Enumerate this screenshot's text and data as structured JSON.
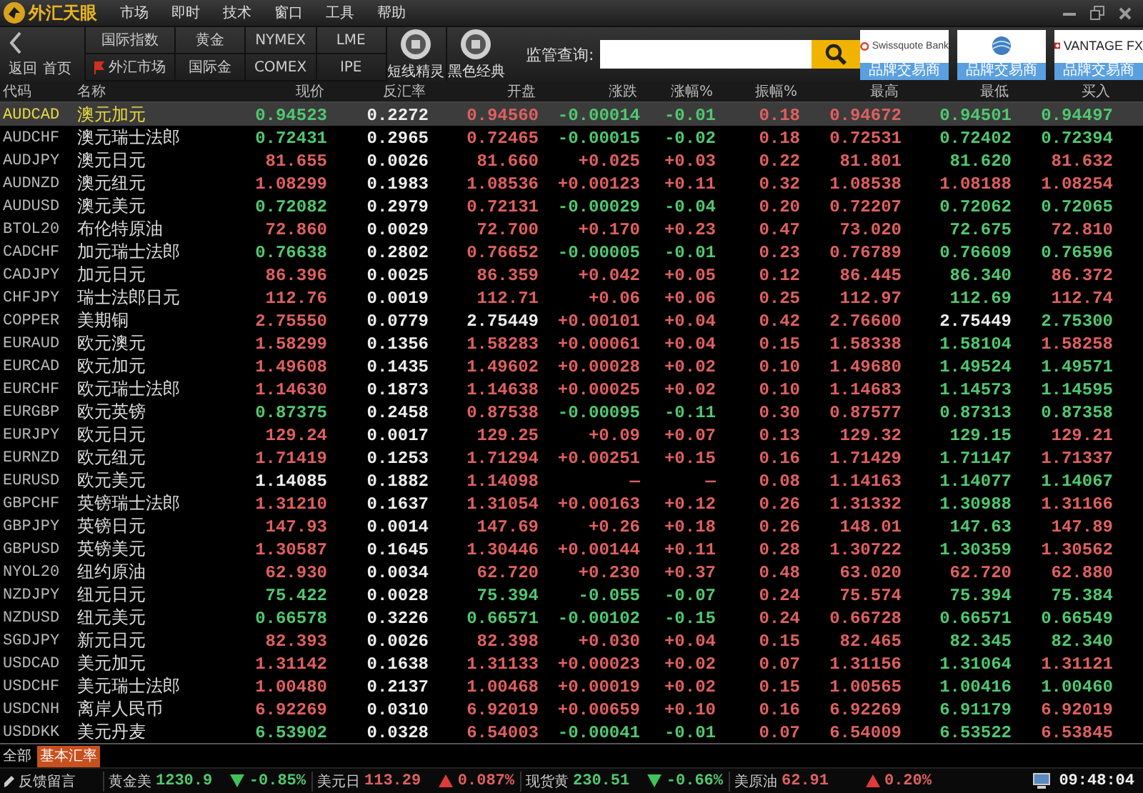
{
  "app": {
    "logo": "外汇天眼",
    "menu": [
      "市场",
      "即时",
      "技术",
      "窗口",
      "工具",
      "帮助"
    ]
  },
  "toolbar": {
    "back": "返回",
    "home": "首页",
    "markets": [
      {
        "top": "国际指数",
        "bottom": "外汇市场",
        "flag": true
      },
      {
        "top": "黄金",
        "bottom": "国际金",
        "flag": false
      },
      {
        "top": "NYMEX",
        "bottom": "COMEX",
        "flag": false
      },
      {
        "top": "LME",
        "bottom": "IPE",
        "flag": false
      }
    ],
    "tools": [
      "短线精灵",
      "黑色经典"
    ],
    "search": {
      "label": "监管查询:"
    },
    "brokers": [
      {
        "kind": "swiss",
        "name": "Swissquote Bank",
        "tag": "品牌交易商"
      },
      {
        "kind": "globe",
        "tag": "品牌交易商"
      },
      {
        "kind": "vantage",
        "name": "VANTAGE FX",
        "tag": "品牌交易商"
      }
    ]
  },
  "table": {
    "columns": [
      "代码",
      "名称",
      "现价",
      "反汇率",
      "开盘",
      "涨跌",
      "涨幅%",
      "振幅%",
      "最高",
      "最低",
      "买入"
    ],
    "rows": [
      {
        "selected": true,
        "cells": [
          {
            "text": "AUDCAD"
          },
          {
            "text": "澳元加元"
          },
          {
            "text": "0.94523",
            "color": "#50c870"
          },
          {
            "text": "0.2272",
            "color": "#eeeeee"
          },
          {
            "text": "0.94560",
            "color": "#e06060"
          },
          {
            "text": "-0.00014",
            "color": "#50c870"
          },
          {
            "text": "-0.01",
            "color": "#50c870"
          },
          {
            "text": "0.18",
            "color": "#e06060"
          },
          {
            "text": "0.94672",
            "color": "#e06060"
          },
          {
            "text": "0.94501",
            "color": "#50c870"
          },
          {
            "text": "0.94497",
            "color": "#50c870"
          }
        ]
      },
      {
        "selected": false,
        "cells": [
          {
            "text": "AUDCHF"
          },
          {
            "text": "澳元瑞士法郎"
          },
          {
            "text": "0.72431",
            "color": "#50c870"
          },
          {
            "text": "0.2965",
            "color": "#eeeeee"
          },
          {
            "text": "0.72465",
            "color": "#e06060"
          },
          {
            "text": "-0.00015",
            "color": "#50c870"
          },
          {
            "text": "-0.02",
            "color": "#50c870"
          },
          {
            "text": "0.18",
            "color": "#e06060"
          },
          {
            "text": "0.72531",
            "color": "#e06060"
          },
          {
            "text": "0.72402",
            "color": "#50c870"
          },
          {
            "text": "0.72394",
            "color": "#50c870"
          }
        ]
      },
      {
        "selected": false,
        "cells": [
          {
            "text": "AUDJPY"
          },
          {
            "text": "澳元日元"
          },
          {
            "text": "81.655",
            "color": "#e06060"
          },
          {
            "text": "0.0026",
            "color": "#eeeeee"
          },
          {
            "text": "81.660",
            "color": "#e06060"
          },
          {
            "text": "+0.025",
            "color": "#e06060"
          },
          {
            "text": "+0.03",
            "color": "#e06060"
          },
          {
            "text": "0.22",
            "color": "#e06060"
          },
          {
            "text": "81.801",
            "color": "#e06060"
          },
          {
            "text": "81.620",
            "color": "#50c870"
          },
          {
            "text": "81.632",
            "color": "#e06060"
          }
        ]
      },
      {
        "selected": false,
        "cells": [
          {
            "text": "AUDNZD"
          },
          {
            "text": "澳元纽元"
          },
          {
            "text": "1.08299",
            "color": "#e06060"
          },
          {
            "text": "0.1983",
            "color": "#eeeeee"
          },
          {
            "text": "1.08536",
            "color": "#e06060"
          },
          {
            "text": "+0.00123",
            "color": "#e06060"
          },
          {
            "text": "+0.11",
            "color": "#e06060"
          },
          {
            "text": "0.32",
            "color": "#e06060"
          },
          {
            "text": "1.08538",
            "color": "#e06060"
          },
          {
            "text": "1.08188",
            "color": "#e06060"
          },
          {
            "text": "1.08254",
            "color": "#e06060"
          }
        ]
      },
      {
        "selected": false,
        "cells": [
          {
            "text": "AUDUSD"
          },
          {
            "text": "澳元美元"
          },
          {
            "text": "0.72082",
            "color": "#50c870"
          },
          {
            "text": "0.2979",
            "color": "#eeeeee"
          },
          {
            "text": "0.72131",
            "color": "#e06060"
          },
          {
            "text": "-0.00029",
            "color": "#50c870"
          },
          {
            "text": "-0.04",
            "color": "#50c870"
          },
          {
            "text": "0.20",
            "color": "#e06060"
          },
          {
            "text": "0.72207",
            "color": "#e06060"
          },
          {
            "text": "0.72062",
            "color": "#50c870"
          },
          {
            "text": "0.72065",
            "color": "#50c870"
          }
        ]
      },
      {
        "selected": false,
        "cells": [
          {
            "text": "BTOL20"
          },
          {
            "text": "布伦特原油"
          },
          {
            "text": "72.860",
            "color": "#e06060"
          },
          {
            "text": "0.0029",
            "color": "#eeeeee"
          },
          {
            "text": "72.700",
            "color": "#e06060"
          },
          {
            "text": "+0.170",
            "color": "#e06060"
          },
          {
            "text": "+0.23",
            "color": "#e06060"
          },
          {
            "text": "0.47",
            "color": "#e06060"
          },
          {
            "text": "73.020",
            "color": "#e06060"
          },
          {
            "text": "72.675",
            "color": "#50c870"
          },
          {
            "text": "72.810",
            "color": "#e06060"
          }
        ]
      },
      {
        "selected": false,
        "cells": [
          {
            "text": "CADCHF"
          },
          {
            "text": "加元瑞士法郎"
          },
          {
            "text": "0.76638",
            "color": "#50c870"
          },
          {
            "text": "0.2802",
            "color": "#eeeeee"
          },
          {
            "text": "0.76652",
            "color": "#e06060"
          },
          {
            "text": "-0.00005",
            "color": "#50c870"
          },
          {
            "text": "-0.01",
            "color": "#50c870"
          },
          {
            "text": "0.23",
            "color": "#e06060"
          },
          {
            "text": "0.76789",
            "color": "#e06060"
          },
          {
            "text": "0.76609",
            "color": "#50c870"
          },
          {
            "text": "0.76596",
            "color": "#50c870"
          }
        ]
      },
      {
        "selected": false,
        "cells": [
          {
            "text": "CADJPY"
          },
          {
            "text": "加元日元"
          },
          {
            "text": "86.396",
            "color": "#e06060"
          },
          {
            "text": "0.0025",
            "color": "#eeeeee"
          },
          {
            "text": "86.359",
            "color": "#e06060"
          },
          {
            "text": "+0.042",
            "color": "#e06060"
          },
          {
            "text": "+0.05",
            "color": "#e06060"
          },
          {
            "text": "0.12",
            "color": "#e06060"
          },
          {
            "text": "86.445",
            "color": "#e06060"
          },
          {
            "text": "86.340",
            "color": "#50c870"
          },
          {
            "text": "86.372",
            "color": "#e06060"
          }
        ]
      },
      {
        "selected": false,
        "cells": [
          {
            "text": "CHFJPY"
          },
          {
            "text": "瑞士法郎日元"
          },
          {
            "text": "112.76",
            "color": "#e06060"
          },
          {
            "text": "0.0019",
            "color": "#eeeeee"
          },
          {
            "text": "112.71",
            "color": "#e06060"
          },
          {
            "text": "+0.06",
            "color": "#e06060"
          },
          {
            "text": "+0.06",
            "color": "#e06060"
          },
          {
            "text": "0.25",
            "color": "#e06060"
          },
          {
            "text": "112.97",
            "color": "#e06060"
          },
          {
            "text": "112.69",
            "color": "#50c870"
          },
          {
            "text": "112.74",
            "color": "#e06060"
          }
        ]
      },
      {
        "selected": false,
        "cells": [
          {
            "text": "COPPER"
          },
          {
            "text": "美期铜"
          },
          {
            "text": "2.75550",
            "color": "#e06060"
          },
          {
            "text": "0.0779",
            "color": "#eeeeee"
          },
          {
            "text": "2.75449",
            "color": "#eeeeee"
          },
          {
            "text": "+0.00101",
            "color": "#e06060"
          },
          {
            "text": "+0.04",
            "color": "#e06060"
          },
          {
            "text": "0.42",
            "color": "#e06060"
          },
          {
            "text": "2.76600",
            "color": "#e06060"
          },
          {
            "text": "2.75449",
            "color": "#eeeeee"
          },
          {
            "text": "2.75300",
            "color": "#50c870"
          }
        ]
      },
      {
        "selected": false,
        "cells": [
          {
            "text": "EURAUD"
          },
          {
            "text": "欧元澳元"
          },
          {
            "text": "1.58299",
            "color": "#e06060"
          },
          {
            "text": "0.1356",
            "color": "#eeeeee"
          },
          {
            "text": "1.58283",
            "color": "#e06060"
          },
          {
            "text": "+0.00061",
            "color": "#e06060"
          },
          {
            "text": "+0.04",
            "color": "#e06060"
          },
          {
            "text": "0.15",
            "color": "#e06060"
          },
          {
            "text": "1.58338",
            "color": "#e06060"
          },
          {
            "text": "1.58104",
            "color": "#50c870"
          },
          {
            "text": "1.58258",
            "color": "#e06060"
          }
        ]
      },
      {
        "selected": false,
        "cells": [
          {
            "text": "EURCAD"
          },
          {
            "text": "欧元加元"
          },
          {
            "text": "1.49608",
            "color": "#e06060"
          },
          {
            "text": "0.1435",
            "color": "#eeeeee"
          },
          {
            "text": "1.49602",
            "color": "#e06060"
          },
          {
            "text": "+0.00028",
            "color": "#e06060"
          },
          {
            "text": "+0.02",
            "color": "#e06060"
          },
          {
            "text": "0.10",
            "color": "#e06060"
          },
          {
            "text": "1.49680",
            "color": "#e06060"
          },
          {
            "text": "1.49524",
            "color": "#50c870"
          },
          {
            "text": "1.49571",
            "color": "#50c870"
          }
        ]
      },
      {
        "selected": false,
        "cells": [
          {
            "text": "EURCHF"
          },
          {
            "text": "欧元瑞士法郎"
          },
          {
            "text": "1.14630",
            "color": "#e06060"
          },
          {
            "text": "0.1873",
            "color": "#eeeeee"
          },
          {
            "text": "1.14638",
            "color": "#e06060"
          },
          {
            "text": "+0.00025",
            "color": "#e06060"
          },
          {
            "text": "+0.02",
            "color": "#e06060"
          },
          {
            "text": "0.10",
            "color": "#e06060"
          },
          {
            "text": "1.14683",
            "color": "#e06060"
          },
          {
            "text": "1.14573",
            "color": "#50c870"
          },
          {
            "text": "1.14595",
            "color": "#50c870"
          }
        ]
      },
      {
        "selected": false,
        "cells": [
          {
            "text": "EURGBP"
          },
          {
            "text": "欧元英镑"
          },
          {
            "text": "0.87375",
            "color": "#50c870"
          },
          {
            "text": "0.2458",
            "color": "#eeeeee"
          },
          {
            "text": "0.87538",
            "color": "#e06060"
          },
          {
            "text": "-0.00095",
            "color": "#50c870"
          },
          {
            "text": "-0.11",
            "color": "#50c870"
          },
          {
            "text": "0.30",
            "color": "#e06060"
          },
          {
            "text": "0.87577",
            "color": "#e06060"
          },
          {
            "text": "0.87313",
            "color": "#50c870"
          },
          {
            "text": "0.87358",
            "color": "#50c870"
          }
        ]
      },
      {
        "selected": false,
        "cells": [
          {
            "text": "EURJPY"
          },
          {
            "text": "欧元日元"
          },
          {
            "text": "129.24",
            "color": "#e06060"
          },
          {
            "text": "0.0017",
            "color": "#eeeeee"
          },
          {
            "text": "129.25",
            "color": "#e06060"
          },
          {
            "text": "+0.09",
            "color": "#e06060"
          },
          {
            "text": "+0.07",
            "color": "#e06060"
          },
          {
            "text": "0.13",
            "color": "#e06060"
          },
          {
            "text": "129.32",
            "color": "#e06060"
          },
          {
            "text": "129.15",
            "color": "#50c870"
          },
          {
            "text": "129.21",
            "color": "#e06060"
          }
        ]
      },
      {
        "selected": false,
        "cells": [
          {
            "text": "EURNZD"
          },
          {
            "text": "欧元纽元"
          },
          {
            "text": "1.71419",
            "color": "#e06060"
          },
          {
            "text": "0.1253",
            "color": "#eeeeee"
          },
          {
            "text": "1.71294",
            "color": "#e06060"
          },
          {
            "text": "+0.00251",
            "color": "#e06060"
          },
          {
            "text": "+0.15",
            "color": "#e06060"
          },
          {
            "text": "0.16",
            "color": "#e06060"
          },
          {
            "text": "1.71429",
            "color": "#e06060"
          },
          {
            "text": "1.71147",
            "color": "#50c870"
          },
          {
            "text": "1.71337",
            "color": "#e06060"
          }
        ]
      },
      {
        "selected": false,
        "cells": [
          {
            "text": "EURUSD"
          },
          {
            "text": "欧元美元"
          },
          {
            "text": "1.14085",
            "color": "#eeeeee"
          },
          {
            "text": "0.1882",
            "color": "#eeeeee"
          },
          {
            "text": "1.14098",
            "color": "#e06060"
          },
          {
            "text": "—",
            "color": "#e06060"
          },
          {
            "text": "—",
            "color": "#e06060"
          },
          {
            "text": "0.08",
            "color": "#e06060"
          },
          {
            "text": "1.14163",
            "color": "#e06060"
          },
          {
            "text": "1.14077",
            "color": "#50c870"
          },
          {
            "text": "1.14067",
            "color": "#50c870"
          }
        ]
      },
      {
        "selected": false,
        "cells": [
          {
            "text": "GBPCHF"
          },
          {
            "text": "英镑瑞士法郎"
          },
          {
            "text": "1.31210",
            "color": "#e06060"
          },
          {
            "text": "0.1637",
            "color": "#eeeeee"
          },
          {
            "text": "1.31054",
            "color": "#e06060"
          },
          {
            "text": "+0.00163",
            "color": "#e06060"
          },
          {
            "text": "+0.12",
            "color": "#e06060"
          },
          {
            "text": "0.26",
            "color": "#e06060"
          },
          {
            "text": "1.31332",
            "color": "#e06060"
          },
          {
            "text": "1.30988",
            "color": "#50c870"
          },
          {
            "text": "1.31166",
            "color": "#e06060"
          }
        ]
      },
      {
        "selected": false,
        "cells": [
          {
            "text": "GBPJPY"
          },
          {
            "text": "英镑日元"
          },
          {
            "text": "147.93",
            "color": "#e06060"
          },
          {
            "text": "0.0014",
            "color": "#eeeeee"
          },
          {
            "text": "147.69",
            "color": "#e06060"
          },
          {
            "text": "+0.26",
            "color": "#e06060"
          },
          {
            "text": "+0.18",
            "color": "#e06060"
          },
          {
            "text": "0.26",
            "color": "#e06060"
          },
          {
            "text": "148.01",
            "color": "#e06060"
          },
          {
            "text": "147.63",
            "color": "#50c870"
          },
          {
            "text": "147.89",
            "color": "#e06060"
          }
        ]
      },
      {
        "selected": false,
        "cells": [
          {
            "text": "GBPUSD"
          },
          {
            "text": "英镑美元"
          },
          {
            "text": "1.30587",
            "color": "#e06060"
          },
          {
            "text": "0.1645",
            "color": "#eeeeee"
          },
          {
            "text": "1.30446",
            "color": "#e06060"
          },
          {
            "text": "+0.00144",
            "color": "#e06060"
          },
          {
            "text": "+0.11",
            "color": "#e06060"
          },
          {
            "text": "0.28",
            "color": "#e06060"
          },
          {
            "text": "1.30722",
            "color": "#e06060"
          },
          {
            "text": "1.30359",
            "color": "#50c870"
          },
          {
            "text": "1.30562",
            "color": "#e06060"
          }
        ]
      },
      {
        "selected": false,
        "cells": [
          {
            "text": "NYOL20"
          },
          {
            "text": "纽约原油"
          },
          {
            "text": "62.930",
            "color": "#e06060"
          },
          {
            "text": "0.0034",
            "color": "#eeeeee"
          },
          {
            "text": "62.720",
            "color": "#e06060"
          },
          {
            "text": "+0.230",
            "color": "#e06060"
          },
          {
            "text": "+0.37",
            "color": "#e06060"
          },
          {
            "text": "0.48",
            "color": "#e06060"
          },
          {
            "text": "63.020",
            "color": "#e06060"
          },
          {
            "text": "62.720",
            "color": "#e06060"
          },
          {
            "text": "62.880",
            "color": "#e06060"
          }
        ]
      },
      {
        "selected": false,
        "cells": [
          {
            "text": "NZDJPY"
          },
          {
            "text": "纽元日元"
          },
          {
            "text": "75.422",
            "color": "#50c870"
          },
          {
            "text": "0.0028",
            "color": "#eeeeee"
          },
          {
            "text": "75.394",
            "color": "#50c870"
          },
          {
            "text": "-0.055",
            "color": "#50c870"
          },
          {
            "text": "-0.07",
            "color": "#50c870"
          },
          {
            "text": "0.24",
            "color": "#e06060"
          },
          {
            "text": "75.574",
            "color": "#e06060"
          },
          {
            "text": "75.394",
            "color": "#50c870"
          },
          {
            "text": "75.384",
            "color": "#50c870"
          }
        ]
      },
      {
        "selected": false,
        "cells": [
          {
            "text": "NZDUSD"
          },
          {
            "text": "纽元美元"
          },
          {
            "text": "0.66578",
            "color": "#50c870"
          },
          {
            "text": "0.3226",
            "color": "#eeeeee"
          },
          {
            "text": "0.66571",
            "color": "#50c870"
          },
          {
            "text": "-0.00102",
            "color": "#50c870"
          },
          {
            "text": "-0.15",
            "color": "#50c870"
          },
          {
            "text": "0.24",
            "color": "#e06060"
          },
          {
            "text": "0.66728",
            "color": "#e06060"
          },
          {
            "text": "0.66571",
            "color": "#50c870"
          },
          {
            "text": "0.66549",
            "color": "#50c870"
          }
        ]
      },
      {
        "selected": false,
        "cells": [
          {
            "text": "SGDJPY"
          },
          {
            "text": "新元日元"
          },
          {
            "text": "82.393",
            "color": "#e06060"
          },
          {
            "text": "0.0026",
            "color": "#eeeeee"
          },
          {
            "text": "82.398",
            "color": "#e06060"
          },
          {
            "text": "+0.030",
            "color": "#e06060"
          },
          {
            "text": "+0.04",
            "color": "#e06060"
          },
          {
            "text": "0.15",
            "color": "#e06060"
          },
          {
            "text": "82.465",
            "color": "#e06060"
          },
          {
            "text": "82.345",
            "color": "#50c870"
          },
          {
            "text": "82.340",
            "color": "#50c870"
          }
        ]
      },
      {
        "selected": false,
        "cells": [
          {
            "text": "USDCAD"
          },
          {
            "text": "美元加元"
          },
          {
            "text": "1.31142",
            "color": "#e06060"
          },
          {
            "text": "0.1638",
            "color": "#eeeeee"
          },
          {
            "text": "1.31133",
            "color": "#e06060"
          },
          {
            "text": "+0.00023",
            "color": "#e06060"
          },
          {
            "text": "+0.02",
            "color": "#e06060"
          },
          {
            "text": "0.07",
            "color": "#e06060"
          },
          {
            "text": "1.31156",
            "color": "#e06060"
          },
          {
            "text": "1.31064",
            "color": "#50c870"
          },
          {
            "text": "1.31121",
            "color": "#e06060"
          }
        ]
      },
      {
        "selected": false,
        "cells": [
          {
            "text": "USDCHF"
          },
          {
            "text": "美元瑞士法郎"
          },
          {
            "text": "1.00480",
            "color": "#e06060"
          },
          {
            "text": "0.2137",
            "color": "#eeeeee"
          },
          {
            "text": "1.00468",
            "color": "#e06060"
          },
          {
            "text": "+0.00019",
            "color": "#e06060"
          },
          {
            "text": "+0.02",
            "color": "#e06060"
          },
          {
            "text": "0.15",
            "color": "#e06060"
          },
          {
            "text": "1.00565",
            "color": "#e06060"
          },
          {
            "text": "1.00416",
            "color": "#50c870"
          },
          {
            "text": "1.00460",
            "color": "#50c870"
          }
        ]
      },
      {
        "selected": false,
        "cells": [
          {
            "text": "USDCNH"
          },
          {
            "text": "离岸人民币"
          },
          {
            "text": "6.92269",
            "color": "#e06060"
          },
          {
            "text": "0.0310",
            "color": "#eeeeee"
          },
          {
            "text": "6.92019",
            "color": "#e06060"
          },
          {
            "text": "+0.00659",
            "color": "#e06060"
          },
          {
            "text": "+0.10",
            "color": "#e06060"
          },
          {
            "text": "0.16",
            "color": "#e06060"
          },
          {
            "text": "6.92269",
            "color": "#e06060"
          },
          {
            "text": "6.91179",
            "color": "#50c870"
          },
          {
            "text": "6.92019",
            "color": "#e06060"
          }
        ]
      },
      {
        "selected": false,
        "cells": [
          {
            "text": "USDDKK"
          },
          {
            "text": "美元丹麦"
          },
          {
            "text": "6.53902",
            "color": "#50c870"
          },
          {
            "text": "0.0328",
            "color": "#eeeeee"
          },
          {
            "text": "6.54003",
            "color": "#e06060"
          },
          {
            "text": "-0.00041",
            "color": "#50c870"
          },
          {
            "text": "-0.01",
            "color": "#50c870"
          },
          {
            "text": "0.07",
            "color": "#e06060"
          },
          {
            "text": "6.54009",
            "color": "#e06060"
          },
          {
            "text": "6.53522",
            "color": "#50c870"
          },
          {
            "text": "6.53845",
            "color": "#e06060"
          }
        ]
      }
    ]
  },
  "tabs": [
    {
      "label": "全部",
      "selected": false
    },
    {
      "label": "基本汇率",
      "selected": true
    }
  ],
  "status_bar": {
    "feedback": "反馈留言",
    "ticker": [
      {
        "name": "黄金美",
        "value": "1230.9",
        "rising": false,
        "change": "-0.85%"
      },
      {
        "name": "美元日",
        "value": "113.29",
        "rising": true,
        "change": "0.087%"
      },
      {
        "name": "现货黄",
        "value": "230.51",
        "rising": false,
        "change": "-0.66%"
      },
      {
        "name": "美原油",
        "value": "62.91",
        "rising": true,
        "change": "0.20%"
      }
    ],
    "time": "09:48:04"
  }
}
